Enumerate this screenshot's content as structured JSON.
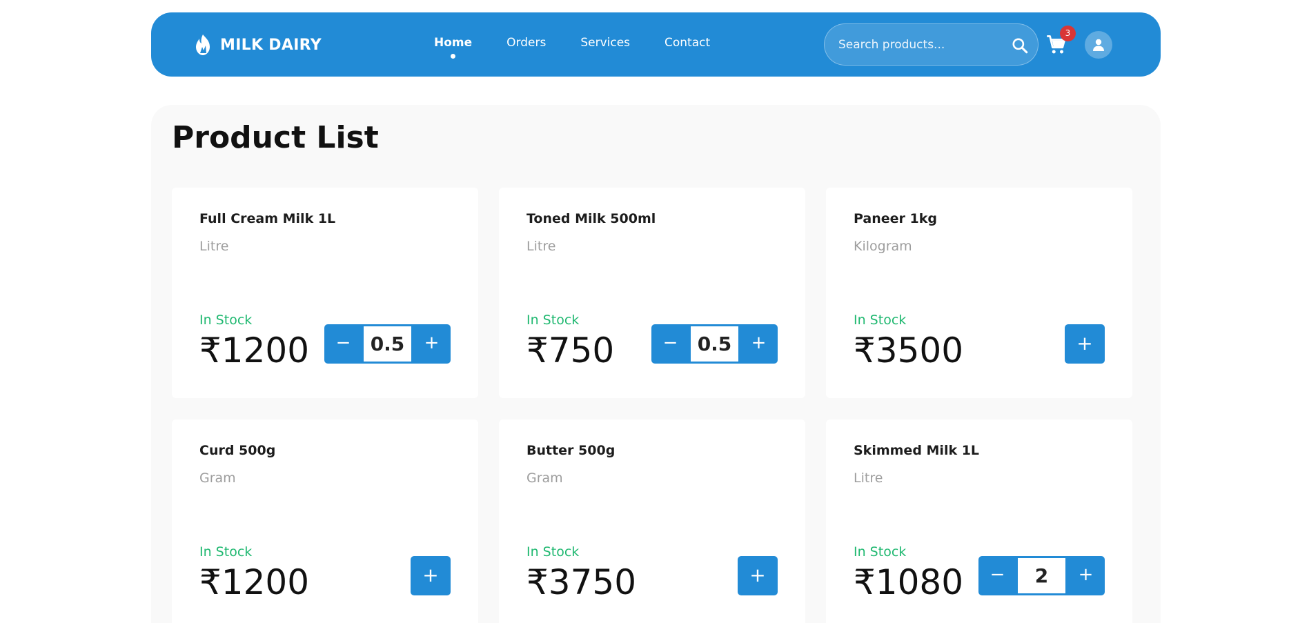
{
  "brand": {
    "name": "MILK DAIRY",
    "icon": "flame-logo-icon"
  },
  "nav": {
    "links": [
      {
        "label": "Home",
        "active": true
      },
      {
        "label": "Orders",
        "active": false
      },
      {
        "label": "Services",
        "active": false
      },
      {
        "label": "Contact",
        "active": false
      }
    ]
  },
  "search": {
    "placeholder": "Search products...",
    "value": "",
    "icon": "search-icon"
  },
  "cart": {
    "count": "3",
    "icon": "cart-icon"
  },
  "user": {
    "icon": "user-icon"
  },
  "colors": {
    "primary": "#228bd6",
    "in_stock": "#1fb870",
    "badge": "#d93636",
    "panel_bg": "#f9f9f9"
  },
  "page": {
    "title": "Product List"
  },
  "products": [
    {
      "name": "Full Cream Milk 1L",
      "unit": "Litre",
      "stock": "In Stock",
      "price": "₹1200",
      "qty": "0.5",
      "minus": "−",
      "plus": "+"
    },
    {
      "name": "Toned Milk 500ml",
      "unit": "Litre",
      "stock": "In Stock",
      "price": "₹750",
      "qty": "0.5",
      "minus": "−",
      "plus": "+"
    },
    {
      "name": "Paneer 1kg",
      "unit": "Kilogram",
      "stock": "In Stock",
      "price": "₹3500",
      "qty": null,
      "plus": "+"
    },
    {
      "name": "Curd 500g",
      "unit": "Gram",
      "stock": "In Stock",
      "price": "₹1200",
      "qty": null,
      "plus": "+"
    },
    {
      "name": "Butter 500g",
      "unit": "Gram",
      "stock": "In Stock",
      "price": "₹3750",
      "qty": null,
      "plus": "+"
    },
    {
      "name": "Skimmed Milk 1L",
      "unit": "Litre",
      "stock": "In Stock",
      "price": "₹1080",
      "qty": "2",
      "minus": "−",
      "plus": "+"
    }
  ]
}
